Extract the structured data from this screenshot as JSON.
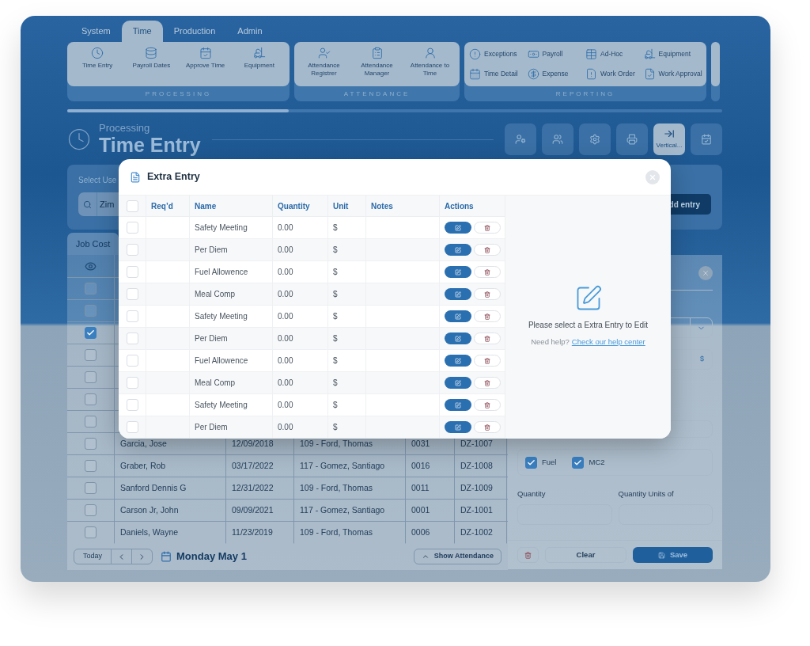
{
  "tabs": [
    {
      "label": "System",
      "selected": false
    },
    {
      "label": "Time",
      "selected": true
    },
    {
      "label": "Production",
      "selected": false
    },
    {
      "label": "Admin",
      "selected": false
    }
  ],
  "ribbon": [
    {
      "title": "PROCESSING",
      "kind": "large",
      "items": [
        "Time Entry",
        "Payroll Dates",
        "Approve Time",
        "Equipment"
      ]
    },
    {
      "title": "ATTENDANCE",
      "kind": "large",
      "items": [
        "Attendance Registrer",
        "Attendance Manager",
        "Attendance to Time"
      ]
    },
    {
      "title": "REPORTING",
      "kind": "compact",
      "items": [
        "Exceptions",
        "Payroll",
        "Ad-Hoc",
        "Equipment",
        "Time Detail",
        "Expense",
        "Work Order",
        "Work Approval"
      ]
    }
  ],
  "page_header": {
    "section": "Processing",
    "title": "Time Entry"
  },
  "toolbar": [
    {
      "selected": false
    },
    {
      "selected": false
    },
    {
      "selected": false
    },
    {
      "selected": false
    },
    {
      "label": "Vertical...",
      "selected": true
    },
    {
      "selected": false
    }
  ],
  "user_select": {
    "label": "Select Use",
    "search_value": "Zim",
    "add_button": "dd entry"
  },
  "job_cost_tab": "Job Cost",
  "job_table": {
    "rows": [
      {
        "checked": false
      },
      {
        "checked": false
      },
      {
        "checked": true
      },
      {
        "checked": false
      },
      {
        "checked": false
      },
      {
        "checked": false
      },
      {
        "checked": false
      },
      {
        "checked": false,
        "cells": [
          "Garcia, Jose",
          "12/09/2018",
          "109 - Ford, Thomas",
          "0031",
          "DZ-1007"
        ]
      },
      {
        "checked": false,
        "cells": [
          "Graber, Rob",
          "03/17/2022",
          "117 - Gomez, Santiago",
          "0016",
          "DZ-1008"
        ]
      },
      {
        "checked": false,
        "cells": [
          "Sanford Dennis G",
          "12/31/2022",
          "109 - Ford, Thomas",
          "0011",
          "DZ-1009"
        ]
      },
      {
        "checked": false,
        "cells": [
          "Carson Jr, John",
          "09/09/2021",
          "117 - Gomez, Santiago",
          "0001",
          "DZ-1001"
        ]
      },
      {
        "checked": false,
        "cells": [
          "Daniels, Wayne",
          "11/23/2019",
          "109 - Ford, Thomas",
          "0006",
          "DZ-1002"
        ]
      }
    ]
  },
  "footer": {
    "today": "Today",
    "date": "Monday May 1",
    "show_attendance": "Show Attendance"
  },
  "detail_panel": {
    "dollar_suffix": "$",
    "checkboxes": [
      {
        "label": "Fuel",
        "checked": true
      },
      {
        "label": "MC2",
        "checked": true
      }
    ],
    "fields": [
      {
        "label": "Quantity"
      },
      {
        "label": "Quantity Units of"
      }
    ],
    "clear": "Clear",
    "save": "Save"
  },
  "modal": {
    "title": "Extra Entry",
    "columns": [
      "Req’d",
      "Name",
      "Quantity",
      "Unit",
      "Notes",
      "Actions"
    ],
    "header_checked": false,
    "rows": [
      {
        "name": "Safety Meeting",
        "quantity": "0.00",
        "unit": "$",
        "checked": false
      },
      {
        "name": "Per Diem",
        "quantity": "0.00",
        "unit": "$",
        "checked": false
      },
      {
        "name": "Fuel Allowence",
        "quantity": "0.00",
        "unit": "$",
        "checked": false
      },
      {
        "name": "Meal Comp",
        "quantity": "0.00",
        "unit": "$",
        "checked": false
      },
      {
        "name": "Safety Meeting",
        "quantity": "0.00",
        "unit": "$",
        "checked": false
      },
      {
        "name": "Per Diem",
        "quantity": "0.00",
        "unit": "$",
        "checked": false
      },
      {
        "name": "Fuel Allowence",
        "quantity": "0.00",
        "unit": "$",
        "checked": false
      },
      {
        "name": "Meal Comp",
        "quantity": "0.00",
        "unit": "$",
        "checked": false
      },
      {
        "name": "Safety Meeting",
        "quantity": "0.00",
        "unit": "$",
        "checked": false
      },
      {
        "name": "Per Diem",
        "quantity": "0.00",
        "unit": "$",
        "checked": false
      }
    ],
    "empty_message": "Please select a Extra Entry to Edit",
    "help_text": "Need help?",
    "help_link": "Check our help center"
  }
}
